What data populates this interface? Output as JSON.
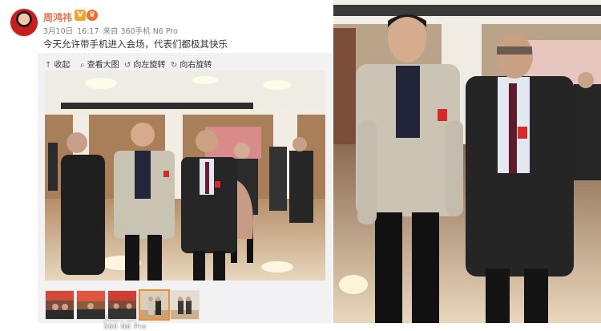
{
  "post": {
    "author": "周鸿祎",
    "badges": {
      "verified": "V",
      "member": "♛"
    },
    "date": "3月10日",
    "time": "16:17",
    "source": "来自 360手机 N6 Pro",
    "text": "今天允许带手机进入会场，代表们都极其快乐"
  },
  "toolbar": {
    "collapse": "收起",
    "view_large": "查看大图",
    "rotate_left": "向左旋转",
    "rotate_right": "向右旋转"
  },
  "watermark": {
    "line1": "SHOT BY",
    "line2": "360 N6 Pro"
  },
  "thumbnails": {
    "count": 5,
    "selected_index": 3
  },
  "icons": {
    "collapse": "arrow-up-icon",
    "view_large": "magnifier-icon",
    "rotate_left": "rotate-left-icon",
    "rotate_right": "rotate-right-icon"
  },
  "colors": {
    "author": "#eb7350",
    "selected_thumb": "#f58b2e"
  }
}
